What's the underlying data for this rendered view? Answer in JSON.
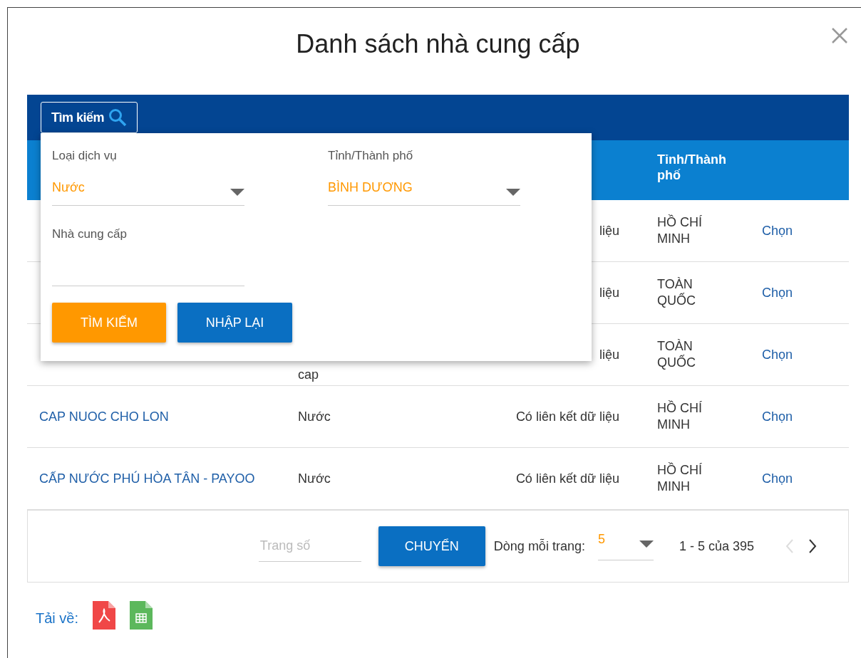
{
  "dialog": {
    "title": "Danh sách nhà cung cấp"
  },
  "toolbar": {
    "search_toggle": "Tìm kiếm"
  },
  "table": {
    "header": {
      "city": "Tỉnh/Thành phố"
    },
    "rows": [
      {
        "status": "liệu",
        "city": "HỒ CHÍ MINH",
        "action": "Chọn"
      },
      {
        "status": "liệu",
        "city": "TOÀN QUỐC",
        "action": "Chọn"
      },
      {
        "service": "cap",
        "status": "liệu",
        "city": "TOÀN QUỐC",
        "action": "Chọn"
      },
      {
        "name": "CAP NUOC CHO LON",
        "service": "Nước",
        "status": "Có liên kết dữ liệu",
        "city": "HỒ CHÍ MINH",
        "action": "Chọn"
      },
      {
        "name": "CẤP NƯỚC PHÚ HÒA TÂN - PAYOO",
        "service": "Nước",
        "status": "Có liên kết dữ liệu",
        "city": "HỒ CHÍ MINH",
        "action": "Chọn"
      }
    ]
  },
  "filter": {
    "fields": [
      {
        "kind": "select",
        "label": "Loại dịch vụ",
        "value": "Nước"
      },
      {
        "kind": "select",
        "label": "Tỉnh/Thành phố",
        "value": "BÌNH DƯƠNG"
      },
      {
        "kind": "text",
        "label": "Nhà cung cấp"
      }
    ],
    "buttons": [
      {
        "kind": "primary",
        "label": "TÌM KIẾM"
      },
      {
        "kind": "secondary",
        "label": "NHẬP LẠI"
      }
    ]
  },
  "pagination": {
    "page_placeholder": "Trang số",
    "go_button": "CHUYỂN",
    "rows_label": "Dòng mỗi trang:",
    "rows_value": "5",
    "range": "1 - 5 của 395",
    "prev": {
      "disabled": true
    },
    "next": {
      "disabled": false
    }
  },
  "downloads": {
    "label": "Tải về:",
    "files": [
      {
        "kind": "pdf"
      },
      {
        "kind": "spreadsheet"
      }
    ]
  }
}
